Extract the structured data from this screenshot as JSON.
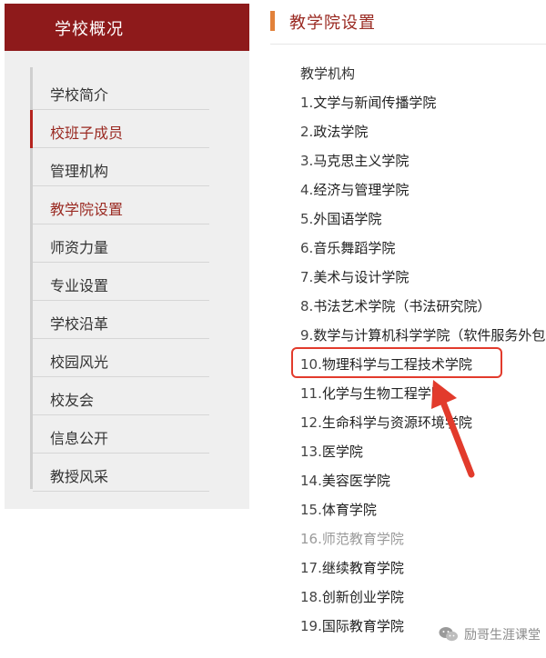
{
  "sidebar": {
    "title": "学校概况",
    "items": [
      {
        "label": "学校简介"
      },
      {
        "label": "校班子成员"
      },
      {
        "label": "管理机构"
      },
      {
        "label": "教学院设置"
      },
      {
        "label": "师资力量"
      },
      {
        "label": "专业设置"
      },
      {
        "label": "学校沿革"
      },
      {
        "label": "校园风光"
      },
      {
        "label": "校友会"
      },
      {
        "label": "信息公开"
      },
      {
        "label": "教授风采"
      }
    ]
  },
  "main": {
    "title": "教学院设置",
    "section_heading": "教学机构",
    "colleges": [
      {
        "num": "1.",
        "name": "文学与新闻传播学院"
      },
      {
        "num": "2.",
        "name": "政法学院"
      },
      {
        "num": "3.",
        "name": "马克思主义学院"
      },
      {
        "num": "4.",
        "name": "经济与管理学院"
      },
      {
        "num": "5.",
        "name": "外国语学院"
      },
      {
        "num": "6.",
        "name": "音乐舞蹈学院"
      },
      {
        "num": "7.",
        "name": "美术与设计学院"
      },
      {
        "num": "8.",
        "name": "书法艺术学院（书法研究院）"
      },
      {
        "num": "9.",
        "name": "数学与计算机科学学院（软件服务外包"
      },
      {
        "num": "10.",
        "name": "物理科学与工程技术学院"
      },
      {
        "num": "11.",
        "name": "化学与生物工程学院"
      },
      {
        "num": "12.",
        "name": "生命科学与资源环境学院"
      },
      {
        "num": "13.",
        "name": "医学院"
      },
      {
        "num": "14.",
        "name": "美容医学院"
      },
      {
        "num": "15.",
        "name": "体育学院"
      },
      {
        "num": "16.",
        "name": "师范教育学院"
      },
      {
        "num": "17.",
        "name": "继续教育学院"
      },
      {
        "num": "18.",
        "name": "创新创业学院"
      },
      {
        "num": "19.",
        "name": "国际教育学院"
      }
    ]
  },
  "watermark": {
    "text": "励哥生涯课堂"
  },
  "colors": {
    "brand": "#8e1a1b",
    "accent": "#e2813a",
    "highlight": "#e23b2c"
  }
}
